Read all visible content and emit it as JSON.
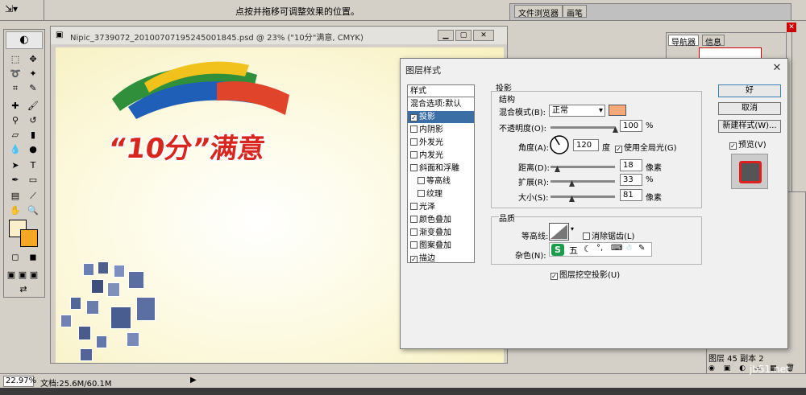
{
  "options_bar": {
    "hint": "点按并拖移可调整效果的位置。",
    "tabs": [
      "文件浏览器",
      "画笔"
    ]
  },
  "document": {
    "title": "Nipic_3739072_20100707195245001845.psd @ 23% (\"10分\"满意, CMYK)",
    "canvas_heading": "“10分”满意"
  },
  "status_bar": {
    "zoom": "22.97%",
    "doc_info": "文档:25.6M/60.1M"
  },
  "nav_panel": {
    "tabs": [
      "导航器",
      "信息"
    ]
  },
  "layers_panel": {
    "layer_name": "图层 45 副本 2"
  },
  "dialog": {
    "title": "图层样式",
    "styles_header": "样式",
    "style_items": [
      {
        "label": "混合选项:默认",
        "checkbox": false,
        "checked": false,
        "indent": false
      },
      {
        "label": "投影",
        "checkbox": true,
        "checked": true,
        "indent": false
      },
      {
        "label": "内阴影",
        "checkbox": true,
        "checked": false,
        "indent": false
      },
      {
        "label": "外发光",
        "checkbox": true,
        "checked": false,
        "indent": false
      },
      {
        "label": "内发光",
        "checkbox": true,
        "checked": false,
        "indent": false
      },
      {
        "label": "斜面和浮雕",
        "checkbox": true,
        "checked": false,
        "indent": false
      },
      {
        "label": "等高线",
        "checkbox": true,
        "checked": false,
        "indent": true
      },
      {
        "label": "纹理",
        "checkbox": true,
        "checked": false,
        "indent": true
      },
      {
        "label": "光泽",
        "checkbox": true,
        "checked": false,
        "indent": false
      },
      {
        "label": "颜色叠加",
        "checkbox": true,
        "checked": false,
        "indent": false
      },
      {
        "label": "渐变叠加",
        "checkbox": true,
        "checked": false,
        "indent": false
      },
      {
        "label": "图案叠加",
        "checkbox": true,
        "checked": false,
        "indent": false
      },
      {
        "label": "描边",
        "checkbox": true,
        "checked": true,
        "indent": false
      }
    ],
    "section_title": "投影",
    "structure": {
      "title": "结构",
      "blend_mode_label": "混合模式(B):",
      "blend_mode_value": "正常",
      "shadow_color": "#f5a878",
      "opacity_label": "不透明度(O):",
      "opacity_value": "100",
      "opacity_fraction": 1.0,
      "percent": "%",
      "angle_label": "角度(A):",
      "angle_value": "120",
      "angle_unit": "度",
      "global_light_label": "使用全局光(G)",
      "distance_label": "距离(D):",
      "distance_value": "18",
      "distance_fraction": 0.1,
      "pixels": "像素",
      "spread_label": "扩展(R):",
      "spread_value": "33",
      "spread_fraction": 0.33,
      "size_label": "大小(S):",
      "size_value": "81",
      "size_fraction": 0.32
    },
    "quality": {
      "title": "品质",
      "contour_label": "等高线:",
      "antialias_label": "消除锯齿(L)",
      "noise_label": "杂色(N):",
      "ime_char": "五",
      "knockout_label": "图层挖空投影(U)"
    },
    "buttons": {
      "ok": "好",
      "cancel": "取消",
      "new_style": "新建样式(W)...",
      "preview": "预览(V)"
    },
    "watermark": "jb51.net"
  }
}
